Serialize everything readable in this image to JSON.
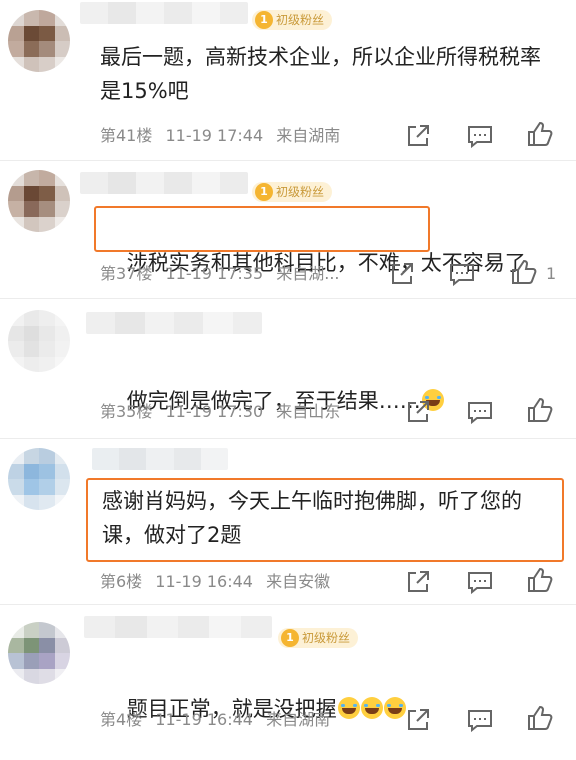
{
  "comments": [
    {
      "badge": "初级粉丝",
      "text": "最后一题，高新技术企业，所以企业所得税税率是15%吧",
      "floor": "第41楼",
      "time": "11-19 17:44",
      "location": "来自湖南",
      "likes": ""
    },
    {
      "badge": "初级粉丝",
      "text_highlighted": "涉税实务和其他科目比，不难，",
      "text_rest": "太不容易了",
      "floor": "第37楼",
      "time": "11-19 17:35",
      "location": "来自湖...",
      "likes": "1"
    },
    {
      "badge": "",
      "text": "做完倒是做完了，至于结果……",
      "floor": "第35楼",
      "time": "11-19 17:30",
      "location": "来自山东",
      "likes": ""
    },
    {
      "badge": "",
      "text": "感谢肖妈妈，今天上午临时抱佛脚，听了您的课，做对了2题",
      "floor": "第6楼",
      "time": "11-19 16:44",
      "location": "来自安徽",
      "likes": ""
    },
    {
      "badge": "初级粉丝",
      "text": "题目正常，就是没把握",
      "floor": "第4楼",
      "time": "11-19 16:44",
      "location": "来自湖南",
      "likes": ""
    }
  ],
  "icons": {
    "share": "share-icon",
    "comment": "comment-icon",
    "like": "thumbs-up-icon",
    "badge": "crown-icon",
    "emoji": "laugh-cry-emoji-icon"
  },
  "colors": {
    "highlight_border": "#f1792a",
    "badge_bg": "#fdf1d6",
    "badge_text": "#c99a3a",
    "text": "#222222",
    "meta": "#8a8a8a"
  }
}
